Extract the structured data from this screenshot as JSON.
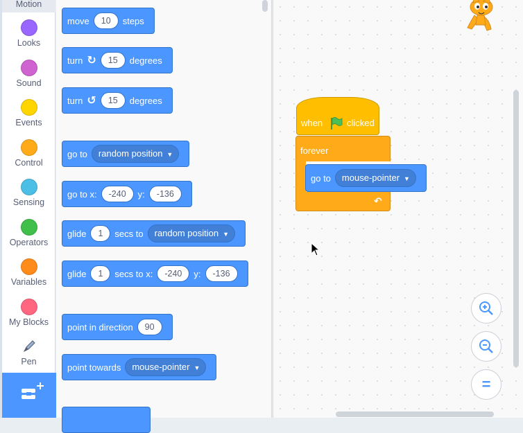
{
  "categories": [
    {
      "label": "Motion",
      "color": "#4c97ff"
    },
    {
      "label": "Looks",
      "color": "#9966ff"
    },
    {
      "label": "Sound",
      "color": "#cf63cf"
    },
    {
      "label": "Events",
      "color": "#ffd500"
    },
    {
      "label": "Control",
      "color": "#ffab19"
    },
    {
      "label": "Sensing",
      "color": "#4cbfe6"
    },
    {
      "label": "Operators",
      "color": "#40bf4a"
    },
    {
      "label": "Variables",
      "color": "#ff8c1a"
    },
    {
      "label": "My Blocks",
      "color": "#ff6680"
    },
    {
      "label": "Pen",
      "color": "#0fbd8c"
    }
  ],
  "palette": {
    "move": {
      "a": "move",
      "v": "10",
      "b": "steps"
    },
    "turn_right": {
      "a": "turn",
      "v": "15",
      "b": "degrees"
    },
    "turn_left": {
      "a": "turn",
      "v": "15",
      "b": "degrees"
    },
    "goto": {
      "a": "go to",
      "d": "random position"
    },
    "goto_xy": {
      "a": "go to x:",
      "x": "-240",
      "b": "y:",
      "y": "-136"
    },
    "glide": {
      "a": "glide",
      "v": "1",
      "b": "secs to",
      "d": "random position"
    },
    "glide_xy": {
      "a": "glide",
      "v": "1",
      "b": "secs to x:",
      "x": "-240",
      "c": "y:",
      "y": "-136"
    },
    "point_dir": {
      "a": "point in direction",
      "v": "90"
    },
    "point_towards": {
      "a": "point towards",
      "d": "mouse-pointer"
    }
  },
  "script": {
    "hat": {
      "a": "when",
      "b": "clicked"
    },
    "forever": "forever",
    "inner": {
      "a": "go to",
      "d": "mouse-pointer"
    }
  },
  "zoom": {
    "in": "zoom-in-icon",
    "out": "zoom-out-icon",
    "reset": "="
  }
}
